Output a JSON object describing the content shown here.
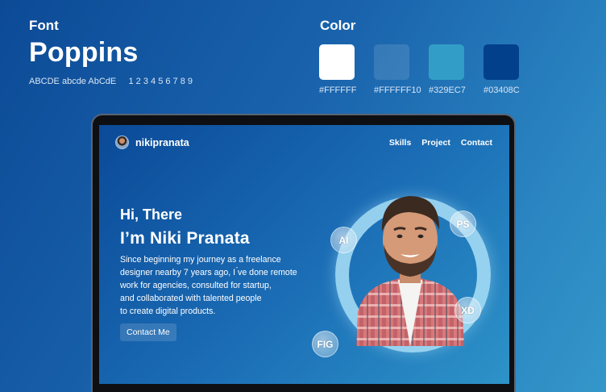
{
  "style_guide": {
    "font_heading": "Font",
    "font_name": "Poppins",
    "font_sample": "ABCDE abcde AbCdE     1 2 3 4 5 6 7 8 9",
    "color_heading": "Color",
    "swatches": [
      {
        "code": "#FFFFFF",
        "color": "#FFFFFF"
      },
      {
        "code": "#FFFFFF10",
        "color": "#FFFFFF1A"
      },
      {
        "code": "#329EC7",
        "color": "#329EC7"
      },
      {
        "code": "#03408C",
        "color": "#03408C"
      }
    ]
  },
  "site": {
    "brand": "nikipranata",
    "nav": [
      "Skills",
      "Project",
      "Contact"
    ],
    "greeting": "Hi, There",
    "headline": "I’m Niki Pranata",
    "description": [
      "Since beginning my journey as a freelance",
      "designer nearby 7 years ago, I ́ve done remote",
      "work for agencies, consulted for startup,",
      "and collaborated with talented people",
      "to create digital products."
    ],
    "cta": "Contact Me",
    "tools": [
      "AI",
      "PS",
      "XD",
      "FIG"
    ]
  }
}
